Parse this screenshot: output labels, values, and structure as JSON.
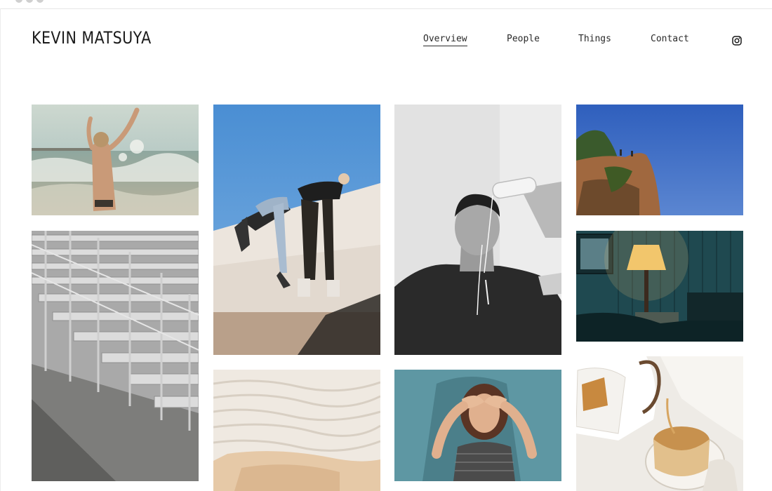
{
  "site": {
    "title": "KEVIN MATSUYA"
  },
  "nav": {
    "items": [
      {
        "label": "Overview",
        "active": true
      },
      {
        "label": "People",
        "active": false
      },
      {
        "label": "Things",
        "active": false
      },
      {
        "label": "Contact",
        "active": false
      }
    ],
    "social_icon": "instagram-icon"
  },
  "gallery": {
    "photos": [
      {
        "subject": "woman-jumping-in-ocean-waves"
      },
      {
        "subject": "empty-metal-bleachers"
      },
      {
        "subject": "two-people-leaning-over-white-wall"
      },
      {
        "subject": "white-travertine-terraces"
      },
      {
        "subject": "man-pouring-water-over-head-bw"
      },
      {
        "subject": "woman-covering-eyes-teal-wall"
      },
      {
        "subject": "rocky-cliff-blue-sky"
      },
      {
        "subject": "lamp-in-teal-room"
      },
      {
        "subject": "teapot-pouring-tea"
      }
    ]
  },
  "colors": {
    "text": "#1a1a1a",
    "background": "#ffffff"
  }
}
